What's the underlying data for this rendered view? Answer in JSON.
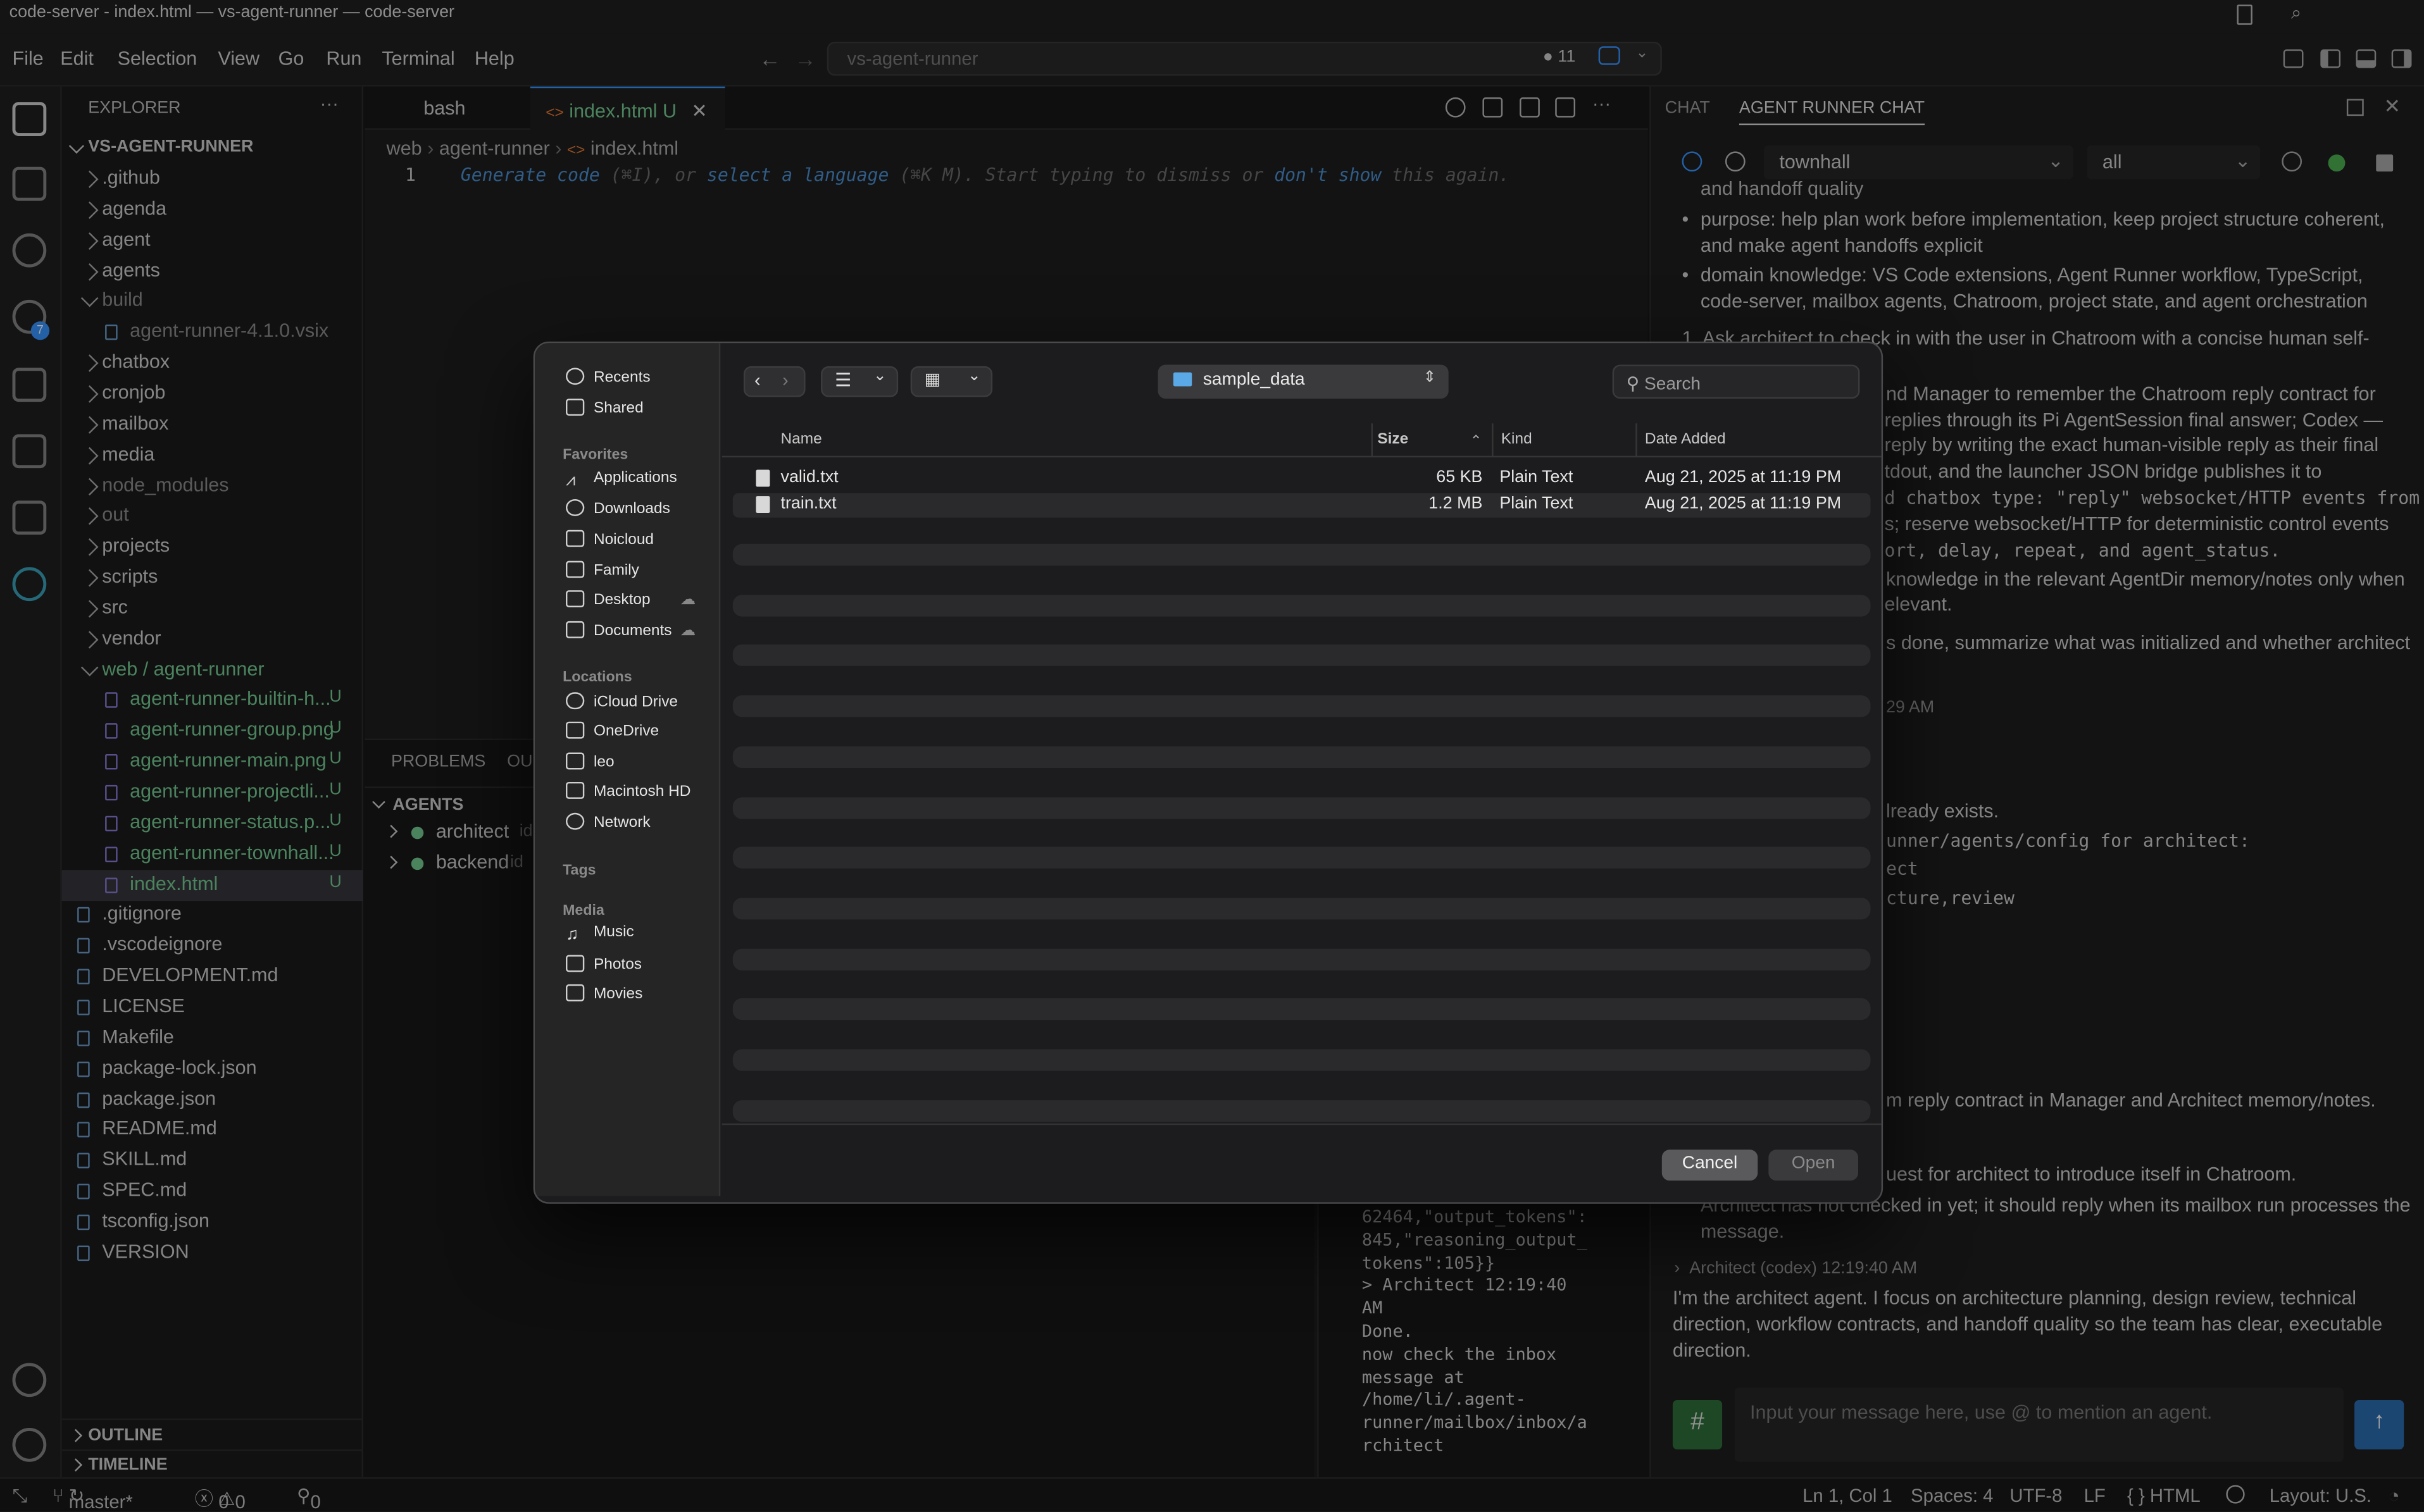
{
  "window": {
    "title": "code-server - index.html — vs-agent-runner — code-server"
  },
  "menu": [
    "File",
    "Edit",
    "Selection",
    "View",
    "Go",
    "Run",
    "Terminal",
    "Help"
  ],
  "command_center": {
    "text": "vs-agent-runner",
    "badge": "11"
  },
  "explorer": {
    "title": "EXPLORER",
    "root": "VS-AGENT-RUNNER",
    "items": [
      {
        "label": ".github",
        "type": "folder"
      },
      {
        "label": "agenda",
        "type": "folder"
      },
      {
        "label": "agent",
        "type": "folder"
      },
      {
        "label": "agents",
        "type": "folder"
      },
      {
        "label": "build",
        "type": "folder-open",
        "dim": true
      },
      {
        "label": "agent-runner-4.1.0.vsix",
        "type": "file",
        "dim": true,
        "indent": 2
      },
      {
        "label": "chatbox",
        "type": "folder"
      },
      {
        "label": "cronjob",
        "type": "folder"
      },
      {
        "label": "mailbox",
        "type": "folder"
      },
      {
        "label": "media",
        "type": "folder"
      },
      {
        "label": "node_modules",
        "type": "folder",
        "dim": true
      },
      {
        "label": "out",
        "type": "folder",
        "dim": true
      },
      {
        "label": "projects",
        "type": "folder"
      },
      {
        "label": "scripts",
        "type": "folder"
      },
      {
        "label": "src",
        "type": "folder"
      },
      {
        "label": "vendor",
        "type": "folder"
      },
      {
        "label": "web / agent-runner",
        "type": "folder-open",
        "git": true
      },
      {
        "label": "agent-runner-builtin-h...",
        "type": "file",
        "git": true,
        "indent": 2,
        "status": "U"
      },
      {
        "label": "agent-runner-group.png",
        "type": "file",
        "git": true,
        "indent": 2,
        "status": "U"
      },
      {
        "label": "agent-runner-main.png",
        "type": "file",
        "git": true,
        "indent": 2,
        "status": "U"
      },
      {
        "label": "agent-runner-projectli...",
        "type": "file",
        "git": true,
        "indent": 2,
        "status": "U"
      },
      {
        "label": "agent-runner-status.p...",
        "type": "file",
        "git": true,
        "indent": 2,
        "status": "U"
      },
      {
        "label": "agent-runner-townhall...",
        "type": "file",
        "git": true,
        "indent": 2,
        "status": "U"
      },
      {
        "label": "index.html",
        "type": "file",
        "git": true,
        "indent": 2,
        "status": "U",
        "selected": true
      },
      {
        "label": ".gitignore",
        "type": "file"
      },
      {
        "label": ".vscodeignore",
        "type": "file"
      },
      {
        "label": "DEVELOPMENT.md",
        "type": "file"
      },
      {
        "label": "LICENSE",
        "type": "file"
      },
      {
        "label": "Makefile",
        "type": "file"
      },
      {
        "label": "package-lock.json",
        "type": "file"
      },
      {
        "label": "package.json",
        "type": "file"
      },
      {
        "label": "README.md",
        "type": "file"
      },
      {
        "label": "SKILL.md",
        "type": "file"
      },
      {
        "label": "SPEC.md",
        "type": "file"
      },
      {
        "label": "tsconfig.json",
        "type": "file"
      },
      {
        "label": "VERSION",
        "type": "file"
      }
    ],
    "outline": "OUTLINE",
    "timeline": "TIMELINE"
  },
  "editor": {
    "tabs": [
      {
        "label": "bash"
      },
      {
        "label": "index.html",
        "status": "U"
      }
    ],
    "breadcrumb": [
      "web",
      "agent-runner",
      "index.html"
    ],
    "line_number": "1",
    "hint_parts": [
      "Generate code",
      " (⌘I), or ",
      "select a language",
      " (⌘K M). Start typing to dismiss or ",
      "don't show",
      " this again."
    ]
  },
  "panel": {
    "tabs": [
      "PROBLEMS",
      "OU"
    ],
    "agents_header": "AGENTS",
    "agents": [
      {
        "name": "architect",
        "suffix": "id"
      },
      {
        "name": "backend",
        "suffix": "id"
      }
    ],
    "terminal_lines": [
      "62464,\"output_tokens\":",
      "845,\"reasoning_output_",
      "tokens\":105}}",
      "> Architect 12:19:40",
      "AM",
      "Done.",
      "now check the inbox",
      "message at",
      "/home/li/.agent-",
      "runner/mailbox/inbox/a",
      "rchitect"
    ]
  },
  "chat": {
    "tabs": [
      "CHAT",
      "AGENT RUNNER CHAT"
    ],
    "channel": "townhall",
    "filter": "all",
    "top_cut": "and handoff quality",
    "bullets": [
      "purpose: help plan work before implementation, keep project structure coherent, and make agent handoffs explicit",
      "domain knowledge: VS Code extensions, Agent Runner workflow, TypeScript, code-server, mailbox agents, Chatroom, project state, and agent orchestration"
    ],
    "numbered_1": "1. Ask architect to check in with the user in Chatroom with a concise human self-",
    "partial_lines": [
      "nd Manager to remember the Chatroom reply contract for",
      "replies through its Pi AgentSession final answer; Codex —",
      "reply by writing the exact human-visible reply as their final",
      "tdout, and the launcher JSON bridge publishes it to",
      "d chatbox type: \"reply\" websocket/HTTP events from",
      "s; reserve websocket/HTTP for deterministic control events",
      "ort, delay, repeat, and agent_status.",
      "knowledge in the relevant AgentDir memory/notes only when",
      "elevant.",
      "s done, summarize what was initialized and whether architect",
      "29 AM",
      "lready exists.",
      "unner/agents/config for architect:",
      "ect",
      "cture,review",
      "m reply contract in Manager and Architect memory/notes.",
      "uest for architect to introduce itself in Chatroom.",
      "Architect has not checked in yet; it should reply when its mailbox run processes the",
      "message."
    ],
    "reply_header": "Architect (codex) 12:19:40 AM",
    "reply_body": "I'm the architect agent. I focus on architecture planning, design review, technical direction, workflow contracts, and handoff quality so the team has clear, executable direction.",
    "input_placeholder": "Input your message here, use @ to mention an agent.",
    "hash": "#"
  },
  "status": {
    "branch": "master*",
    "errors": "0",
    "warnings": "0",
    "ports": "0",
    "position": "Ln 1, Col 1",
    "spaces": "Spaces: 4",
    "encoding": "UTF-8",
    "eol": "LF",
    "lang": "{ } HTML",
    "layout": "Layout: U.S."
  },
  "dialog": {
    "sidebar": {
      "top": [
        "Recents",
        "Shared"
      ],
      "favorites_label": "Favorites",
      "favorites": [
        "Applications",
        "Downloads",
        "Noicloud",
        "Family",
        "Desktop",
        "Documents"
      ],
      "locations_label": "Locations",
      "locations": [
        "iCloud Drive",
        "OneDrive",
        "leo",
        "Macintosh HD",
        "Network"
      ],
      "tags_label": "Tags",
      "media_label": "Media",
      "media": [
        "Music",
        "Photos",
        "Movies"
      ]
    },
    "folder": "sample_data",
    "search_placeholder": "Search",
    "columns": [
      "Name",
      "Size",
      "Kind",
      "Date Added"
    ],
    "files": [
      {
        "name": "valid.txt",
        "size": "65 KB",
        "kind": "Plain Text",
        "date": "Aug 21, 2025 at 11:19 PM"
      },
      {
        "name": "train.txt",
        "size": "1.2 MB",
        "kind": "Plain Text",
        "date": "Aug 21, 2025 at 11:19 PM"
      }
    ],
    "cancel": "Cancel",
    "open": "Open"
  },
  "colors": {
    "accent": "#3794ff",
    "git_untracked": "#73c991",
    "modified": "#c9b86a",
    "chat_send": "#2b6cb0"
  }
}
